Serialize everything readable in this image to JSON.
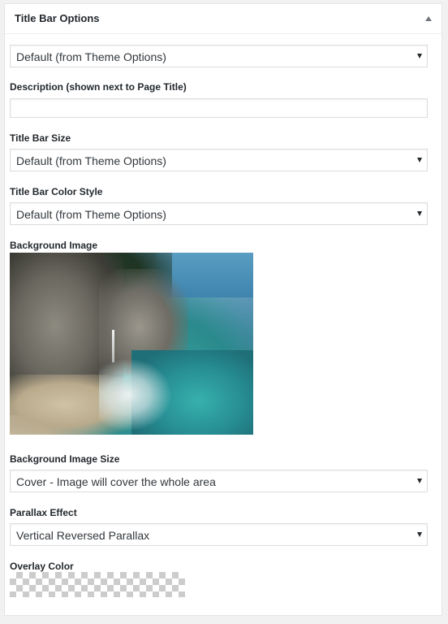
{
  "panel": {
    "title": "Title Bar Options",
    "collapse_icon": "triangle-up-icon"
  },
  "fields": {
    "title_bar": {
      "value": "Default (from Theme Options)"
    },
    "description": {
      "label": "Description (shown next to Page Title)",
      "value": ""
    },
    "title_bar_size": {
      "label": "Title Bar Size",
      "value": "Default (from Theme Options)"
    },
    "title_bar_color_style": {
      "label": "Title Bar Color Style",
      "value": "Default (from Theme Options)"
    },
    "background_image": {
      "label": "Background Image"
    },
    "background_image_size": {
      "label": "Background Image Size",
      "value": "Cover - Image will cover the whole area"
    },
    "parallax_effect": {
      "label": "Parallax Effect",
      "value": "Vertical Reversed Parallax"
    },
    "overlay_color": {
      "label": "Overlay Color"
    }
  },
  "colors": {
    "panel_bg": "#ffffff",
    "page_bg": "#f1f1f1",
    "border": "#dddddd",
    "text": "#23282d"
  }
}
